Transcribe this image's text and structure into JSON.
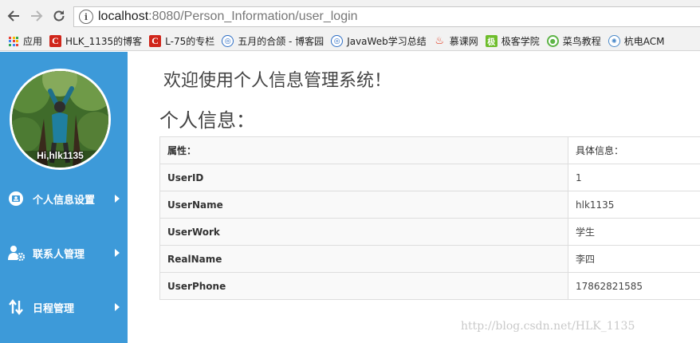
{
  "browser": {
    "url_host": "localhost",
    "url_rest": ":8080/Person_Information/user_login"
  },
  "bookmarks": [
    {
      "label": "应用",
      "icon": "apps-icon"
    },
    {
      "label": "HLK_1135的博客",
      "icon": "csdn-icon"
    },
    {
      "label": "L-75的专栏",
      "icon": "csdn-icon"
    },
    {
      "label": "五月的合颌 - 博客园",
      "icon": "cnblogs-icon"
    },
    {
      "label": "JavaWeb学习总结",
      "icon": "cnblogs-icon"
    },
    {
      "label": "慕课网",
      "icon": "imooc-flame-icon"
    },
    {
      "label": "极客学院",
      "icon": "jikexueyuan-icon"
    },
    {
      "label": "菜鸟教程",
      "icon": "runoob-icon"
    },
    {
      "label": "杭电ACM",
      "icon": "hdu-acm-icon"
    }
  ],
  "sidebar": {
    "avatar_label": "Hi,hlk1135",
    "items": [
      {
        "label": "个人信息设置",
        "icon": "person-card-icon"
      },
      {
        "label": "联系人管理",
        "icon": "contacts-gear-icon"
      },
      {
        "label": "日程管理",
        "icon": "schedule-swap-icon"
      }
    ]
  },
  "main": {
    "welcome": "欢迎使用个人信息管理系统！",
    "section_title": "个人信息：",
    "table": {
      "headers": [
        "属性：",
        "具体信息："
      ],
      "rows": [
        {
          "key": "UserID",
          "value": "1"
        },
        {
          "key": "UserName",
          "value": "hlk1135"
        },
        {
          "key": "UserWork",
          "value": "学生"
        },
        {
          "key": "RealName",
          "value": "李四"
        },
        {
          "key": "UserPhone",
          "value": "17862821585"
        }
      ]
    }
  },
  "watermark": "http://blog.csdn.net/HLK_1135",
  "colors": {
    "sidebar": "#3d9ad9",
    "addressbar": "#f2f2f2"
  }
}
